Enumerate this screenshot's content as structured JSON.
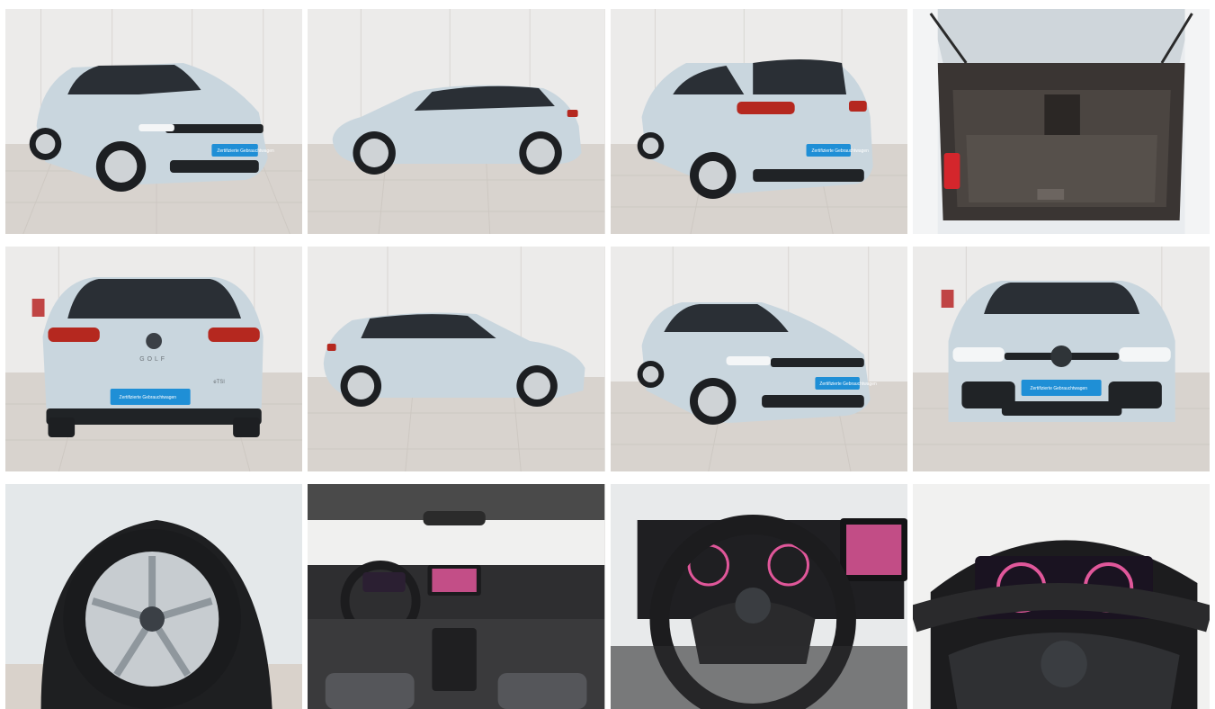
{
  "gallery": {
    "tiles": [
      {
        "label": "front-three-quarter-left",
        "plate_text": "Zertifizierte Gebrauchtwagen"
      },
      {
        "label": "side-left",
        "plate_text": ""
      },
      {
        "label": "rear-three-quarter-left",
        "plate_text": "Zertifizierte Gebrauchtwagen"
      },
      {
        "label": "trunk-open",
        "plate_text": ""
      },
      {
        "label": "rear",
        "plate_text": "Zertifizierte Gebrauchtwagen",
        "badge": "GOLF",
        "trim_badge": "eTSI"
      },
      {
        "label": "side-right",
        "plate_text": ""
      },
      {
        "label": "front-three-quarter-right",
        "plate_text": "Zertifizierte Gebrauchtwagen"
      },
      {
        "label": "front",
        "plate_text": "Zertifizierte Gebrauchtwagen"
      },
      {
        "label": "wheel-closeup",
        "plate_text": ""
      },
      {
        "label": "interior-dashboard",
        "plate_text": ""
      },
      {
        "label": "steering-wheel",
        "plate_text": ""
      },
      {
        "label": "instrument-cluster",
        "plate_text": ""
      }
    ]
  },
  "colors": {
    "paint": "#c9d6de",
    "plate_blue": "#1f8fd6",
    "showroom_wall": "#ecebea",
    "showroom_floor": "#d8d3ce",
    "display_pink": "#e0579a"
  }
}
